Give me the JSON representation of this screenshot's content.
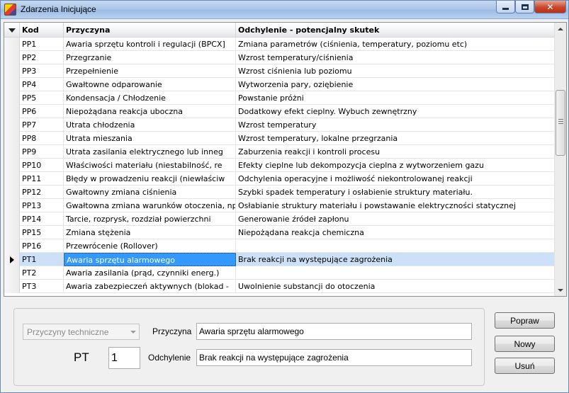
{
  "window": {
    "title": "Zdarzenia Inicjujące"
  },
  "grid": {
    "columns": {
      "kod": "Kod",
      "przyczyna": "Przyczyna",
      "odchylenie": "Odchylenie - potencjalny skutek"
    },
    "rows": [
      {
        "kod": "PP1",
        "przyczyna": "Awaria sprzętu kontroli i regulacji (BPCX]",
        "odchylenie": "Zmiana parametrów (ciśnienia, temperatury, poziomu etc)"
      },
      {
        "kod": "PP2",
        "przyczyna": "Przegrzanie",
        "odchylenie": "Wzrost temperatury/ciśnienia"
      },
      {
        "kod": "PP3",
        "przyczyna": "Przepełnienie",
        "odchylenie": "Wzrost ciśnienia lub poziomu"
      },
      {
        "kod": "PP4",
        "przyczyna": "Gwałtowne odparowanie",
        "odchylenie": "Wytworzenia pary, oziębienie"
      },
      {
        "kod": "PP5",
        "przyczyna": "Kondensacja / Chłodzenie",
        "odchylenie": "Powstanie próżni"
      },
      {
        "kod": "PP6",
        "przyczyna": "Niepożądana reakcja uboczna",
        "odchylenie": "Dodatkowy efekt cieplny. Wybuch zewnętrzny"
      },
      {
        "kod": "PP7",
        "przyczyna": "Utrata chłodzenia",
        "odchylenie": "Wzrost temperatury"
      },
      {
        "kod": "PP8",
        "przyczyna": "Utrata mieszania",
        "odchylenie": "Wzrost temperatury, lokalne przegrzania"
      },
      {
        "kod": "PP9",
        "przyczyna": "Utrata zasilania elektrycznego lub inneg",
        "odchylenie": "Zaburzenia reakcji i kontroli procesu"
      },
      {
        "kod": "PP10",
        "przyczyna": "Właściwości materiału (niestabilność, re",
        "odchylenie": "Efekty cieplne lub dekompozycja cieplna z wytworzeniem gazu"
      },
      {
        "kod": "PP11",
        "przyczyna": "Błędy w prowadzeniu reakcji  (niewłaściw",
        "odchylenie": "Odchylenia operacyjne i możliwość niekontrolowanej reakcji"
      },
      {
        "kod": "PP12",
        "przyczyna": "Gwałtowny zmiana ciśnienia",
        "odchylenie": "Szybki spadek temperatury i osłabienie struktury materiału."
      },
      {
        "kod": "PP13",
        "przyczyna": "Gwałtowna zmiana warunków otoczenia, np.",
        "odchylenie": "Osłabianie struktury materiału i powstawanie elektryczności statycznej"
      },
      {
        "kod": "PP14",
        "przyczyna": "Tarcie, rozprysk, rozdział powierzchni",
        "odchylenie": "Generowanie źródeł zapłonu"
      },
      {
        "kod": "PP15",
        "przyczyna": "Zmiana stężenia",
        "odchylenie": "Niepożądana reakcja chemiczna"
      },
      {
        "kod": "PP16",
        "przyczyna": "Przewrócenie (Rollover)",
        "odchylenie": ""
      },
      {
        "kod": "PT1",
        "przyczyna": "Awaria sprzętu alarmowego",
        "odchylenie": "Brak reakcji na występujące zagrożenia"
      },
      {
        "kod": "PT2",
        "przyczyna": "Awaria zasilania (prąd, czynniki energ.)",
        "odchylenie": ""
      },
      {
        "kod": "PT3",
        "przyczyna": "Awaria zabezpieczeń aktywnych (blokad -",
        "odchylenie": "Uwolnienie substancji do otoczenia"
      }
    ],
    "selected_index": 16
  },
  "form": {
    "category_select": "Przyczyny techniczne",
    "przyczyna_label": "Przyczyna",
    "przyczyna_value": "Awaria sprzętu alarmowego",
    "prefix_label": "PT",
    "number_value": "1",
    "odchylenie_label": "Odchylenie",
    "odchylenie_value": "Brak reakcji na występujące zagrożenia"
  },
  "buttons": {
    "popraw": "Popraw",
    "nowy": "Nowy",
    "usun": "Usuń"
  }
}
